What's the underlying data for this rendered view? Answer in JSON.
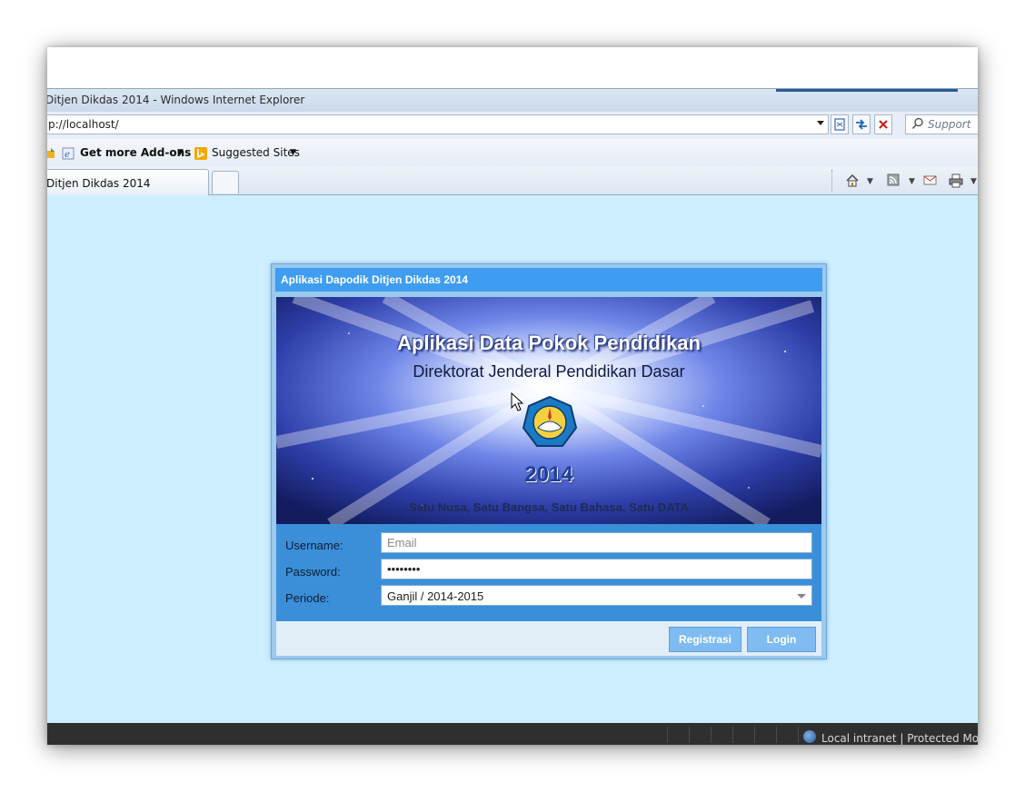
{
  "browser": {
    "window_title": "Ditjen Dikdas 2014 - Windows Internet Explorer",
    "address": "p://localhost/",
    "search_placeholder": "Support",
    "favorites": {
      "addons_label": "Get more Add-ons",
      "suggested_label": "Suggested Sites"
    },
    "tab_title": "Ditjen Dikdas 2014",
    "status_text": "Local intranet | Protected Mode:"
  },
  "login": {
    "panel_title": "Aplikasi Dapodik Ditjen Dikdas 2014",
    "banner": {
      "title": "Aplikasi Data Pokok Pendidikan",
      "subtitle": "Direktorat Jenderal Pendidikan Dasar",
      "year": "2014",
      "motto": "Satu Nusa, Satu Bangsa, Satu Bahasa, Satu DATA"
    },
    "username_label": "Username:",
    "username_placeholder": "Email",
    "username_value": "",
    "password_label": "Password:",
    "password_value": "password",
    "periode_label": "Periode:",
    "periode_value": "Ganjil / 2014-2015",
    "register_button": "Registrasi",
    "login_button": "Login"
  },
  "colors": {
    "content_bg": "#cdeefe",
    "panel_header": "#3e9df0",
    "form_bg": "#3a8fd8",
    "button_bg": "#7ebbf0"
  },
  "icons": [
    "page-icon",
    "dropdown-icon",
    "compat-view-icon",
    "refresh-icon",
    "stop-icon",
    "search-icon",
    "addons-icon",
    "ie-icon",
    "bing-icon",
    "home-icon",
    "feeds-icon",
    "mail-icon",
    "print-icon",
    "globe-icon",
    "ministry-emblem",
    "mouse-cursor"
  ]
}
